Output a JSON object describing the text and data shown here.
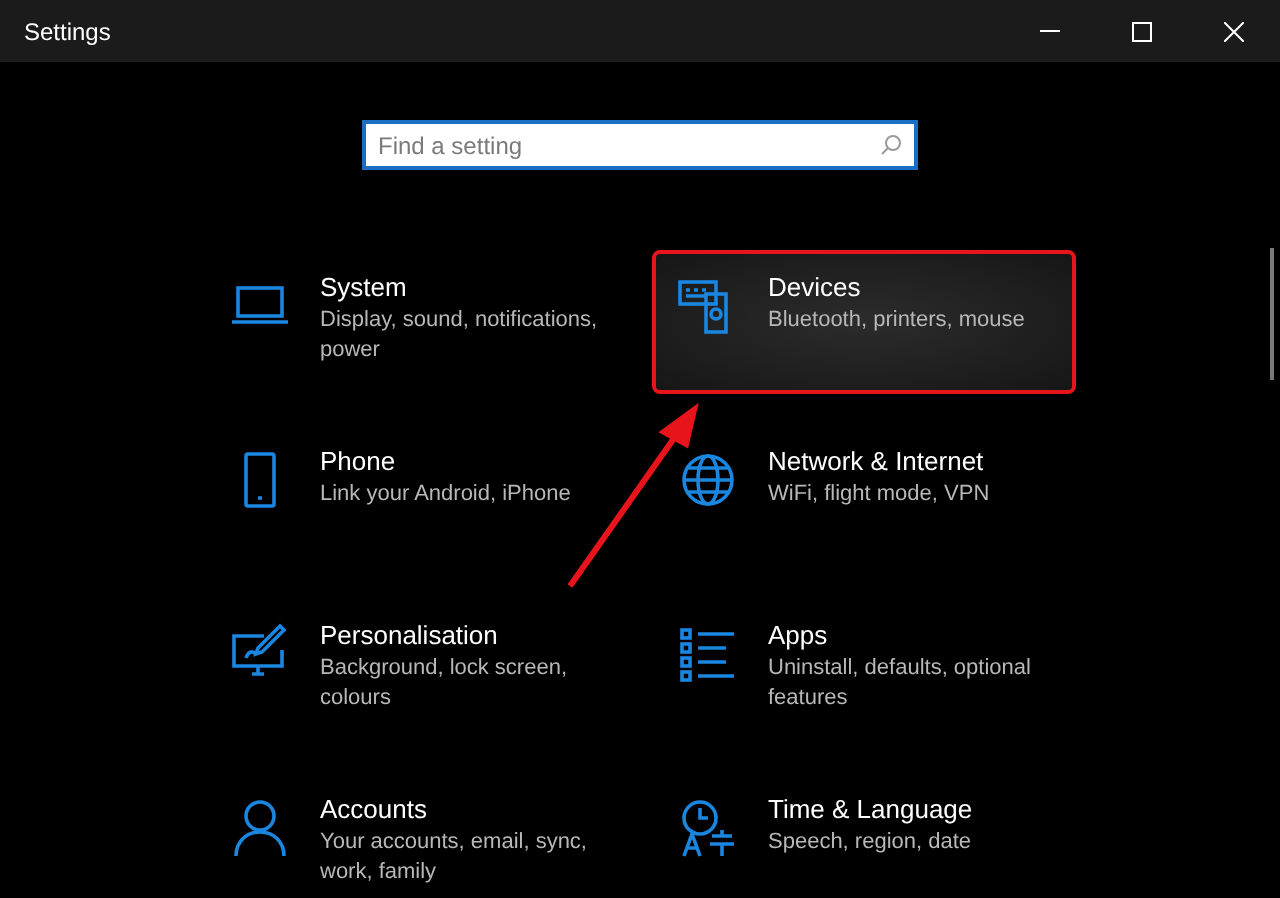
{
  "window": {
    "title": "Settings"
  },
  "search": {
    "placeholder": "Find a setting"
  },
  "categories": [
    {
      "title": "System",
      "description": "Display, sound, notifications, power",
      "selected": false,
      "annotated": false
    },
    {
      "title": "Devices",
      "description": "Bluetooth, printers, mouse",
      "selected": true,
      "annotated": true
    },
    {
      "title": "Phone",
      "description": "Link your Android, iPhone",
      "selected": false,
      "annotated": false
    },
    {
      "title": "Network & Internet",
      "description": "WiFi, flight mode, VPN",
      "selected": false,
      "annotated": false
    },
    {
      "title": "Personalisation",
      "description": "Background, lock screen, colours",
      "selected": false,
      "annotated": false
    },
    {
      "title": "Apps",
      "description": "Uninstall, defaults, optional features",
      "selected": false,
      "annotated": false
    },
    {
      "title": "Accounts",
      "description": "Your accounts, email, sync, work, family",
      "selected": false,
      "annotated": false
    },
    {
      "title": "Time & Language",
      "description": "Speech, region, date",
      "selected": false,
      "annotated": false
    }
  ]
}
